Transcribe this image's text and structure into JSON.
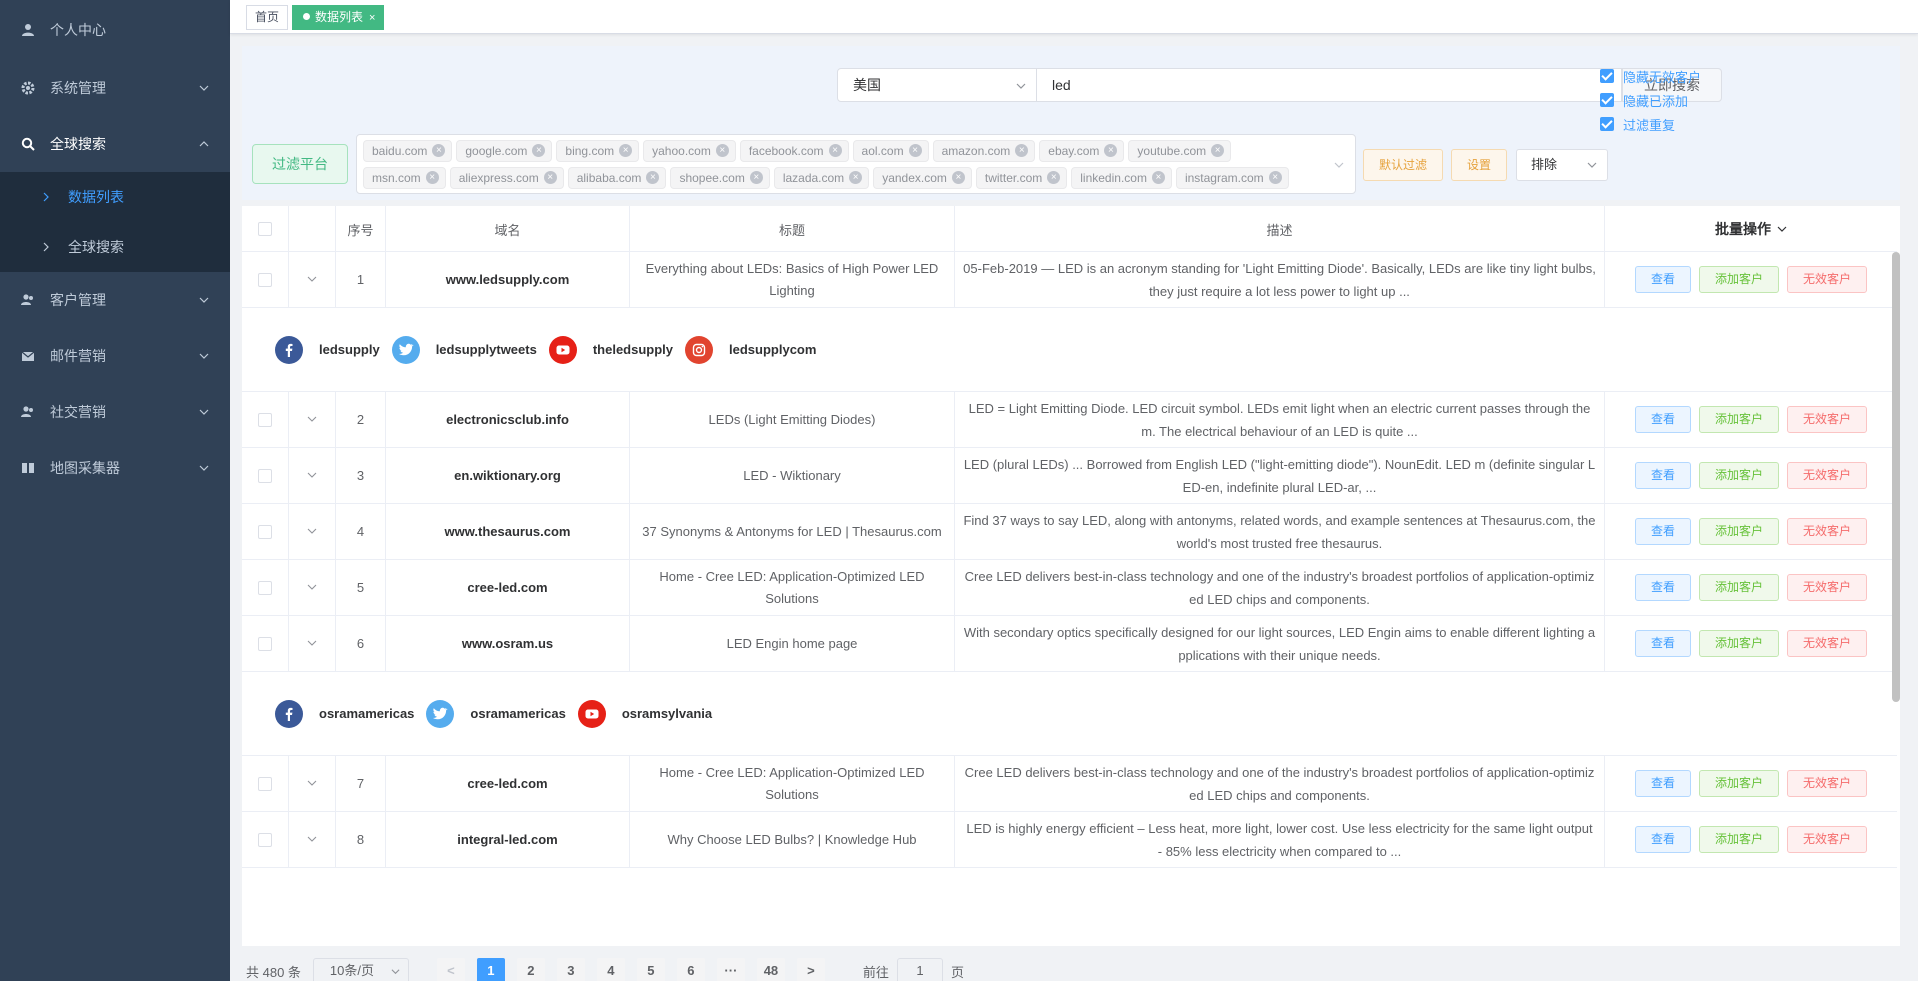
{
  "sidebar": {
    "items": [
      {
        "label": "个人中心",
        "icon": "user-icon"
      },
      {
        "label": "系统管理",
        "icon": "gear-icon"
      },
      {
        "label": "全球搜索",
        "icon": "search-icon"
      },
      {
        "label": "客户管理",
        "icon": "users-icon"
      },
      {
        "label": "邮件营销",
        "icon": "mail-icon"
      },
      {
        "label": "社交营销",
        "icon": "users-icon"
      },
      {
        "label": "地图采集器",
        "icon": "book-icon"
      }
    ],
    "submenu": [
      {
        "label": "数据列表",
        "active": true
      },
      {
        "label": "全球搜索",
        "active": false
      }
    ]
  },
  "tags": {
    "home": "首页",
    "active": "数据列表",
    "close": "×"
  },
  "search": {
    "country": "美国",
    "keyword": "led",
    "button": "立即搜索",
    "options": [
      "隐藏无效客户",
      "隐藏已添加",
      "过滤重复"
    ]
  },
  "filter": {
    "button": "过滤平台",
    "platforms_row1": [
      "baidu.com",
      "google.com",
      "bing.com",
      "yahoo.com",
      "facebook.com",
      "aol.com",
      "amazon.com",
      "ebay.com",
      "youtube.com"
    ],
    "platforms_row2": [
      "msn.com",
      "aliexpress.com",
      "alibaba.com",
      "shopee.com",
      "lazada.com",
      "yandex.com",
      "twitter.com",
      "linkedin.com",
      "instagram.com"
    ],
    "default_button": "默认过滤",
    "settings_button": "设置",
    "exclude": "排除"
  },
  "table": {
    "headers": {
      "index": "序号",
      "domain": "域名",
      "title": "标题",
      "desc": "描述",
      "batch": "批量操作"
    },
    "actions": {
      "view": "查看",
      "add": "添加客户",
      "invalid": "无效客户"
    },
    "rows": [
      {
        "index": "1",
        "domain": "www.ledsupply.com",
        "title": "Everything about LEDs: Basics of High Power LED Lighting",
        "desc": "05-Feb-2019 — LED is an acronym standing for 'Light Emitting Diode'. Basically, LEDs are like tiny light bulbs, they just require a lot less power to light up ..."
      },
      {
        "index": "2",
        "domain": "electronicsclub.info",
        "title": "LEDs (Light Emitting Diodes)",
        "desc": "LED = Light Emitting Diode. LED circuit symbol. LEDs emit light when an electric current passes through them. The electrical behaviour of an LED is quite ..."
      },
      {
        "index": "3",
        "domain": "en.wiktionary.org",
        "title": "LED - Wiktionary",
        "desc": "LED (plural LEDs) ... Borrowed from English LED (\"light-emitting diode\"). NounEdit. LED m (definite singular LED-en, indefinite plural LED-ar, ..."
      },
      {
        "index": "4",
        "domain": "www.thesaurus.com",
        "title": "37 Synonyms & Antonyms for LED | Thesaurus.com",
        "desc": "Find 37 ways to say LED, along with antonyms, related words, and example sentences at Thesaurus.com, the world's most trusted free thesaurus."
      },
      {
        "index": "5",
        "domain": "cree-led.com",
        "title": "Home - Cree LED: Application-Optimized LED Solutions",
        "desc": "Cree LED delivers best-in-class technology and one of the industry's broadest portfolios of application-optimized LED chips and components."
      },
      {
        "index": "6",
        "domain": "www.osram.us",
        "title": "LED Engin home page",
        "desc": "With secondary optics specifically designed for our light sources, LED Engin aims to enable different lighting applications with their unique needs."
      },
      {
        "index": "7",
        "domain": "cree-led.com",
        "title": "Home - Cree LED: Application-Optimized LED Solutions",
        "desc": "Cree LED delivers best-in-class technology and one of the industry's broadest portfolios of application-optimized LED chips and components."
      },
      {
        "index": "8",
        "domain": "integral-led.com",
        "title": "Why Choose LED Bulbs? | Knowledge Hub",
        "desc": "LED is highly energy efficient – Less heat, more light, lower cost. Use less electricity for the same light output - 85% less electricity when compared to ..."
      }
    ],
    "social1": [
      {
        "icon": "facebook-icon",
        "name": "ledsupply",
        "color": "#3b5998"
      },
      {
        "icon": "twitter-icon",
        "name": "ledsupplytweets",
        "color": "#55acee"
      },
      {
        "icon": "youtube-icon",
        "name": "theledsupply",
        "color": "#e62117"
      },
      {
        "icon": "instagram-icon",
        "name": "ledsupplycom",
        "color": "#e1442f"
      }
    ],
    "social2": [
      {
        "icon": "facebook-icon",
        "name": "osramamericas",
        "color": "#3b5998"
      },
      {
        "icon": "twitter-icon",
        "name": "osramamericas",
        "color": "#55acee"
      },
      {
        "icon": "youtube-icon",
        "name": "osramsylvania",
        "color": "#e62117"
      }
    ]
  },
  "pagination": {
    "total": "共 480 条",
    "page_size": "10条/页",
    "prev": "<",
    "next": ">",
    "pages": [
      "1",
      "2",
      "3",
      "4",
      "5",
      "6",
      "···",
      "48"
    ],
    "current": "1",
    "goto_label": "前往",
    "goto_value": "1",
    "goto_suffix": "页"
  }
}
